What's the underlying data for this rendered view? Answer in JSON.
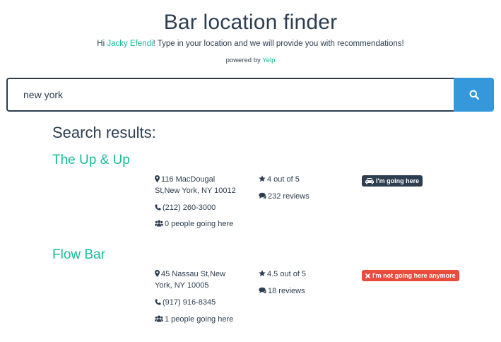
{
  "header": {
    "title": "Bar location finder",
    "greeting_prefix": "Hi ",
    "user_name": "Jacky Efendi",
    "greeting_suffix": "! Type in your location and we will provide you with recommendations!",
    "powered_prefix": "powered by ",
    "powered_link": "Yelp"
  },
  "search": {
    "value": "new york",
    "placeholder": "",
    "button_icon": "search-icon"
  },
  "results": {
    "heading": "Search results:",
    "items": [
      {
        "name": "The Up & Up",
        "address_line1": "116 MacDougal",
        "address_line2": "St,New York, NY 10012",
        "phone": "(212) 260-3000",
        "going": "0 people going here",
        "rating": "4 out of 5",
        "reviews": "232 reviews",
        "action_label": "I'm going here",
        "action_icon": "car-icon",
        "action_color": "#2c3e50"
      },
      {
        "name": "Flow Bar",
        "address_line1": "45 Nassau St,New",
        "address_line2": "York, NY 10005",
        "phone": "(917) 916-8345",
        "going": "1 people going here",
        "rating": "4.5 out of 5",
        "reviews": "18 reviews",
        "action_label": "I'm not going here anymore",
        "action_icon": "close-icon",
        "action_color": "#e74c3c"
      }
    ]
  },
  "colors": {
    "primary": "#2c3e50",
    "accent": "#18bc9c",
    "info": "#3498db",
    "danger": "#e74c3c"
  }
}
